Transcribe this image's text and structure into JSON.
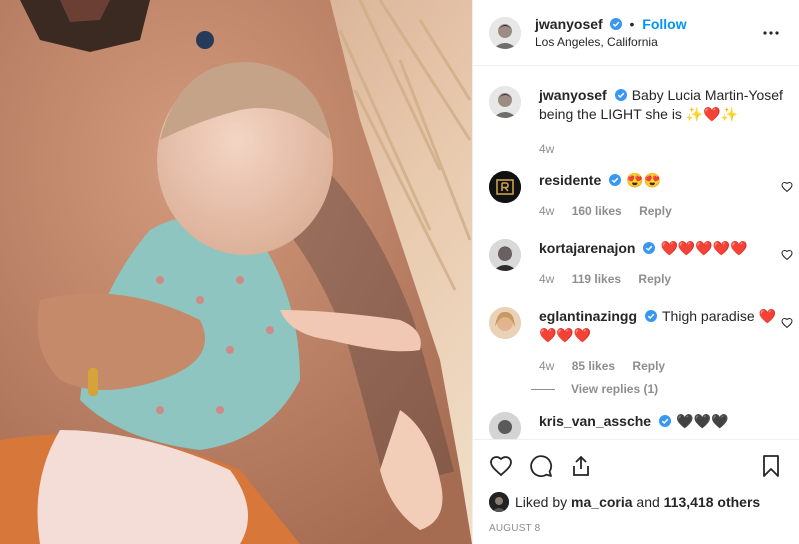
{
  "header": {
    "username": "jwanyosef",
    "dot": "•",
    "follow": "Follow",
    "location": "Los Angeles, California"
  },
  "caption": {
    "username": "jwanyosef",
    "text": "Baby Lucia Martin-Yosef being the LIGHT she is ✨❤️✨",
    "time": "4w"
  },
  "comments": [
    {
      "username": "residente",
      "verified": true,
      "text": "😍😍",
      "time": "4w",
      "likes": "160 likes",
      "reply": "Reply"
    },
    {
      "username": "kortajarenajon",
      "verified": true,
      "text": "❤️❤️❤️❤️❤️",
      "time": "4w",
      "likes": "119 likes",
      "reply": "Reply"
    },
    {
      "username": "eglantinazingg",
      "verified": true,
      "text": "Thigh paradise ❤️❤️❤️❤️",
      "time": "4w",
      "likes": "85 likes",
      "reply": "Reply",
      "view_replies": "View replies (1)"
    },
    {
      "username": "kris_van_assche",
      "verified": true,
      "text": "🖤🖤🖤"
    }
  ],
  "likes": {
    "prefix": "Liked by",
    "user": "ma_coria",
    "and": "and",
    "count": "113,418 others"
  },
  "date": "AUGUST 8",
  "colors": {
    "link": "#0095f6",
    "verified": "#3897f0",
    "heart": "#ed4956",
    "muted": "#8e8e8e"
  },
  "icons": [
    "more-options-icon",
    "heart-icon",
    "comment-icon",
    "share-icon",
    "bookmark-icon",
    "verified-icon"
  ]
}
